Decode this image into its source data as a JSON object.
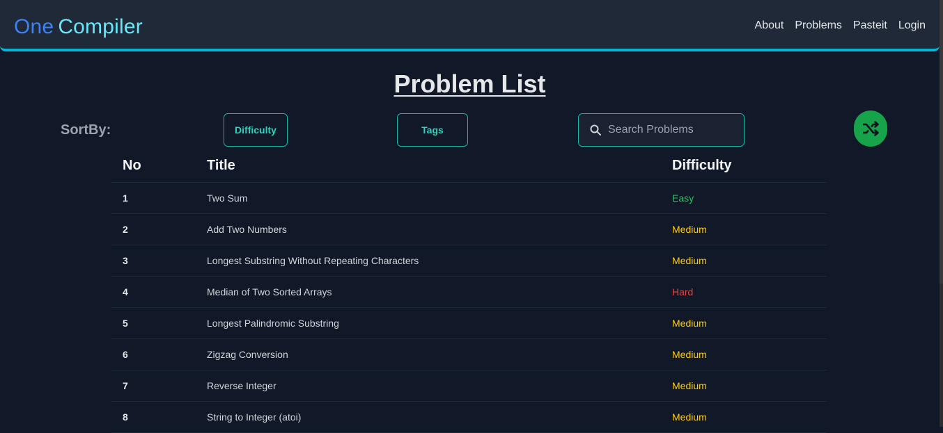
{
  "header": {
    "logo_part1": "One",
    "logo_part2": "Compiler",
    "nav": [
      "About",
      "Problems",
      "Pasteit",
      "Login"
    ]
  },
  "page_title": "Problem List",
  "sort": {
    "label": "SortBy:",
    "difficulty_button": "Difficulty",
    "tags_button": "Tags"
  },
  "search": {
    "placeholder": "Search Problems"
  },
  "icons": {
    "search": "search-icon",
    "shuffle": "shuffle-icon"
  },
  "colors": {
    "accent": "#06b6d4",
    "easy": "#22c55e",
    "medium": "#facc15",
    "hard": "#ef4444",
    "shuffle_button": "#16a34a"
  },
  "table": {
    "headers": [
      "No",
      "Title",
      "Difficulty"
    ],
    "rows": [
      {
        "no": "1",
        "title": "Two Sum",
        "difficulty": "Easy"
      },
      {
        "no": "2",
        "title": "Add Two Numbers",
        "difficulty": "Medium"
      },
      {
        "no": "3",
        "title": "Longest Substring Without Repeating Characters",
        "difficulty": "Medium"
      },
      {
        "no": "4",
        "title": "Median of Two Sorted Arrays",
        "difficulty": "Hard"
      },
      {
        "no": "5",
        "title": "Longest Palindromic Substring",
        "difficulty": "Medium"
      },
      {
        "no": "6",
        "title": "Zigzag Conversion",
        "difficulty": "Medium"
      },
      {
        "no": "7",
        "title": "Reverse Integer",
        "difficulty": "Medium"
      },
      {
        "no": "8",
        "title": "String to Integer (atoi)",
        "difficulty": "Medium"
      }
    ]
  }
}
